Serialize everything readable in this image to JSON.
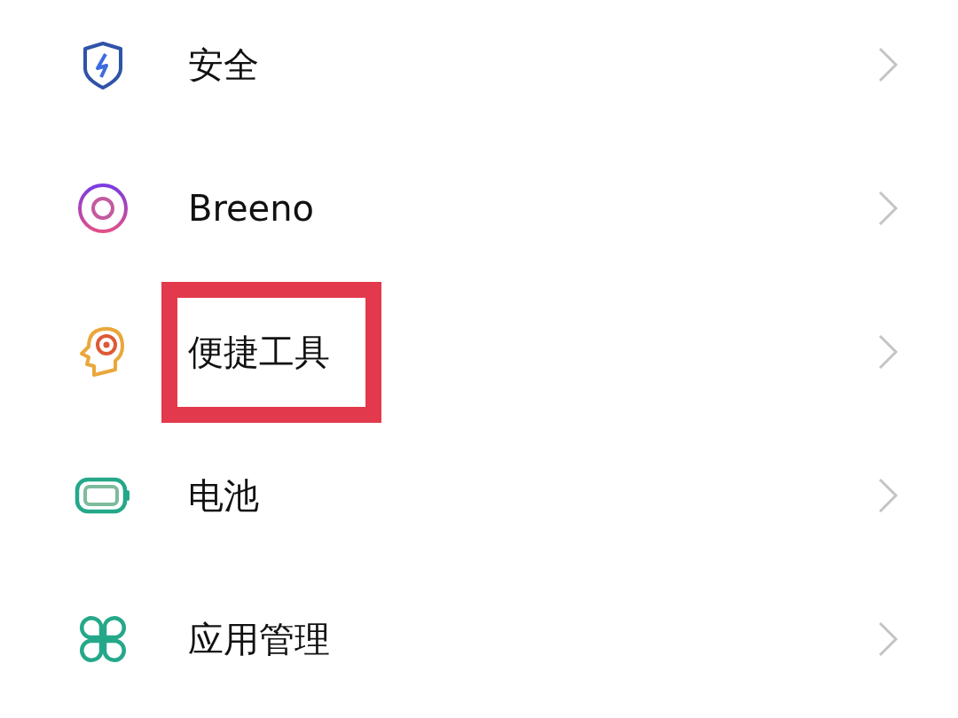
{
  "settings": [
    {
      "label": "安全",
      "highlighted": false
    },
    {
      "label": "Breeno",
      "highlighted": false
    },
    {
      "label": "便捷工具",
      "highlighted": true
    },
    {
      "label": "电池",
      "highlighted": false
    },
    {
      "label": "应用管理",
      "highlighted": false
    }
  ]
}
